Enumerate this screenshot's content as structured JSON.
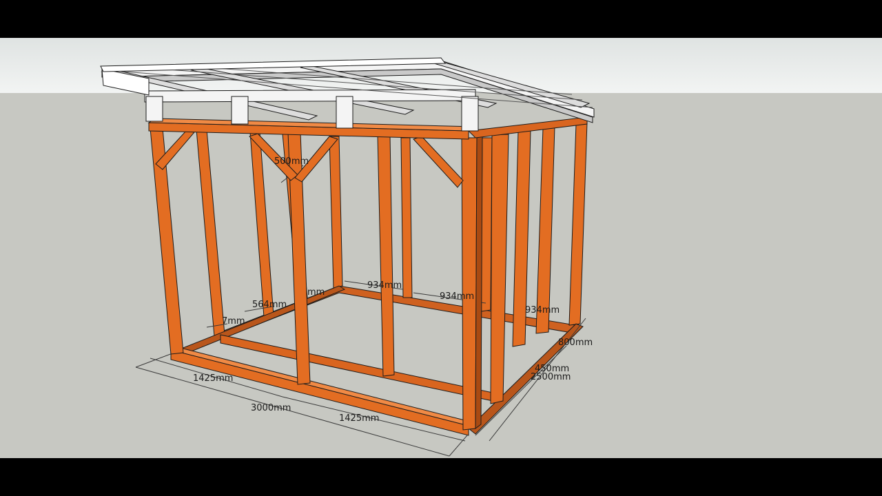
{
  "colors": {
    "sky_top": "#dfe3e2",
    "sky_bottom": "#f2f4f3",
    "ground": "#c7c8c2",
    "wood": "#e36d22",
    "wood_dark": "#a94a12",
    "roof_top": "#f4f4f4",
    "roof_side": "#c9c9c9",
    "edge": "#1b1b1b",
    "dimension_line": "#3a3a3a",
    "letterbox": "#000000"
  },
  "dimensions": {
    "bottom_left_segment": "1425mm",
    "bottom_total": "3000mm",
    "bottom_right_segment": "1425mm",
    "side_450": "450mm",
    "side_total": "2500mm",
    "side_top": "800mm",
    "back_934_a": "934mm",
    "back_934_b": "934mm",
    "back_934_c": "934mm",
    "left_564": "564mm",
    "left_7mm": "7mm",
    "back_mm": "mm",
    "brace_500": "500mm"
  }
}
